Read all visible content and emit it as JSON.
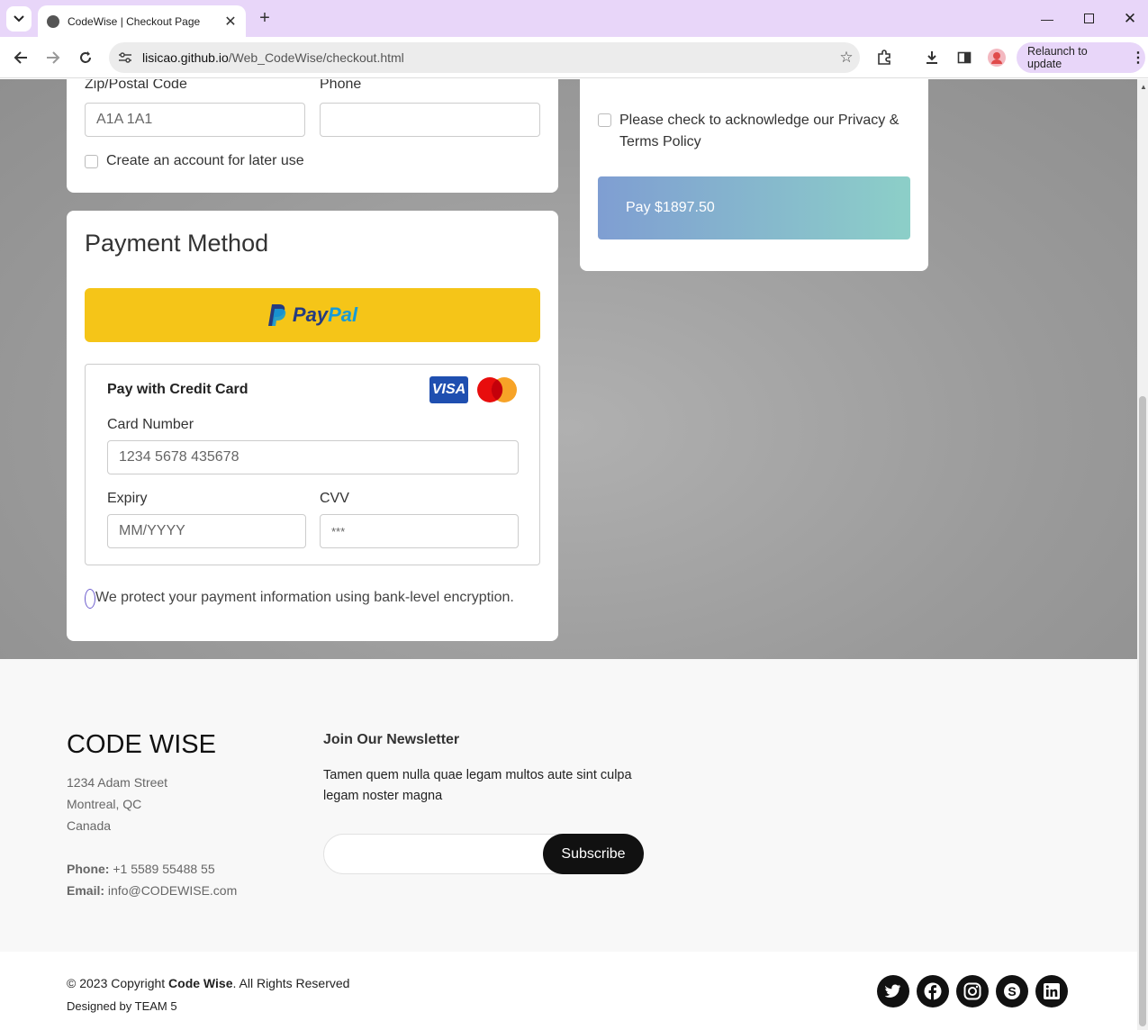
{
  "browser": {
    "tab_title": "CodeWise | Checkout Page",
    "url_host": "lisicao.github.io",
    "url_path": "/Web_CodeWise/checkout.html",
    "relaunch_label": "Relaunch to update"
  },
  "billing": {
    "zip_label": "Zip/Postal Code",
    "zip_placeholder": "A1A 1A1",
    "phone_label": "Phone",
    "create_account_label": "Create an account for later use"
  },
  "payment": {
    "title": "Payment Method",
    "paypal_pay": "Pay",
    "paypal_pal": "Pal",
    "credit_card_title": "Pay with Credit Card",
    "visa_label": "VISA",
    "card_number_label": "Card Number",
    "card_number_placeholder": "1234 5678 435678",
    "expiry_label": "Expiry",
    "expiry_placeholder": "MM/YYYY",
    "cvv_label": "CVV",
    "cvv_placeholder": "***",
    "security_note": "We protect your payment information using bank-level encryption."
  },
  "summary": {
    "privacy_text": "Please check to acknowledge our Privacy & Terms Policy",
    "pay_button": "Pay $1897.50"
  },
  "footer": {
    "brand": "CODE WISE",
    "address_line1": "1234 Adam Street",
    "address_line2": "Montreal, QC",
    "address_line3": "Canada",
    "phone_label": "Phone:",
    "phone_value": "+1 5589 55488 55",
    "email_label": "Email:",
    "email_value": "info@CODEWISE.com",
    "newsletter_title": "Join Our Newsletter",
    "newsletter_text": "Tamen quem nulla quae legam multos aute sint culpa legam noster magna",
    "subscribe_label": "Subscribe",
    "copyright_prefix": "© 2023 Copyright ",
    "copyright_brand": "Code Wise",
    "copyright_suffix": ". All Rights Reserved",
    "designed_by": "Designed by TEAM 5"
  },
  "colors": {
    "paypal_yellow": "#f5c518",
    "pay_gradient_start": "#7f9ed2",
    "pay_gradient_end": "#8ccfc8",
    "visa_blue": "#1f4fb0"
  }
}
